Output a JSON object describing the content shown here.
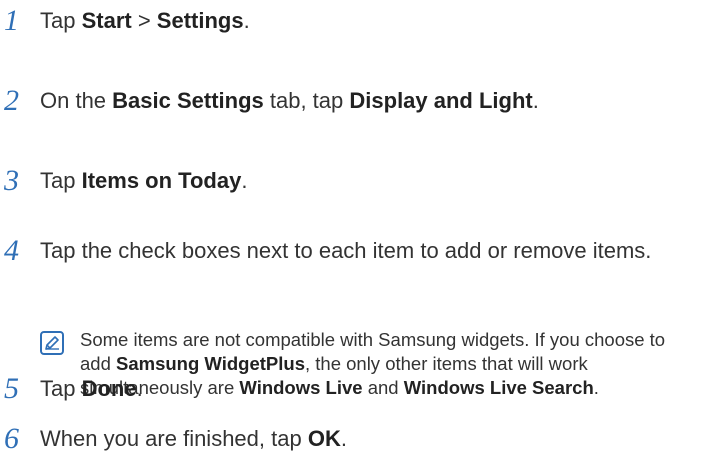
{
  "accent_color": "#2f6fb6",
  "steps": [
    {
      "num": "1",
      "parts": [
        {
          "t": "Tap "
        },
        {
          "t": "Start",
          "b": true
        },
        {
          "t": " > "
        },
        {
          "t": "Settings",
          "b": true
        },
        {
          "t": "."
        }
      ]
    },
    {
      "num": "2",
      "parts": [
        {
          "t": "On the "
        },
        {
          "t": "Basic Settings",
          "b": true
        },
        {
          "t": " tab, tap "
        },
        {
          "t": "Display and Light",
          "b": true
        },
        {
          "t": "."
        }
      ]
    },
    {
      "num": "3",
      "parts": [
        {
          "t": "Tap "
        },
        {
          "t": "Items on Today",
          "b": true
        },
        {
          "t": "."
        }
      ]
    },
    {
      "num": "4",
      "parts": [
        {
          "t": "Tap the check boxes next to each item to add or remove items."
        }
      ]
    },
    {
      "num": "5",
      "parts": [
        {
          "t": "Tap "
        },
        {
          "t": "Done",
          "b": true
        },
        {
          "t": "."
        }
      ]
    },
    {
      "num": "6",
      "parts": [
        {
          "t": "When you are finished, tap "
        },
        {
          "t": "OK",
          "b": true
        },
        {
          "t": "."
        }
      ]
    }
  ],
  "note": {
    "icon": "note-pencil-icon",
    "parts": [
      {
        "t": "Some items are not compatible with Samsung widgets. If you choose to add "
      },
      {
        "t": "Samsung WidgetPlus",
        "b": true
      },
      {
        "t": ", the only other items that will work simultaneously are "
      },
      {
        "t": "Windows Live",
        "b": true
      },
      {
        "t": " and "
      },
      {
        "t": "Windows Live Search",
        "b": true
      },
      {
        "t": "."
      }
    ]
  }
}
